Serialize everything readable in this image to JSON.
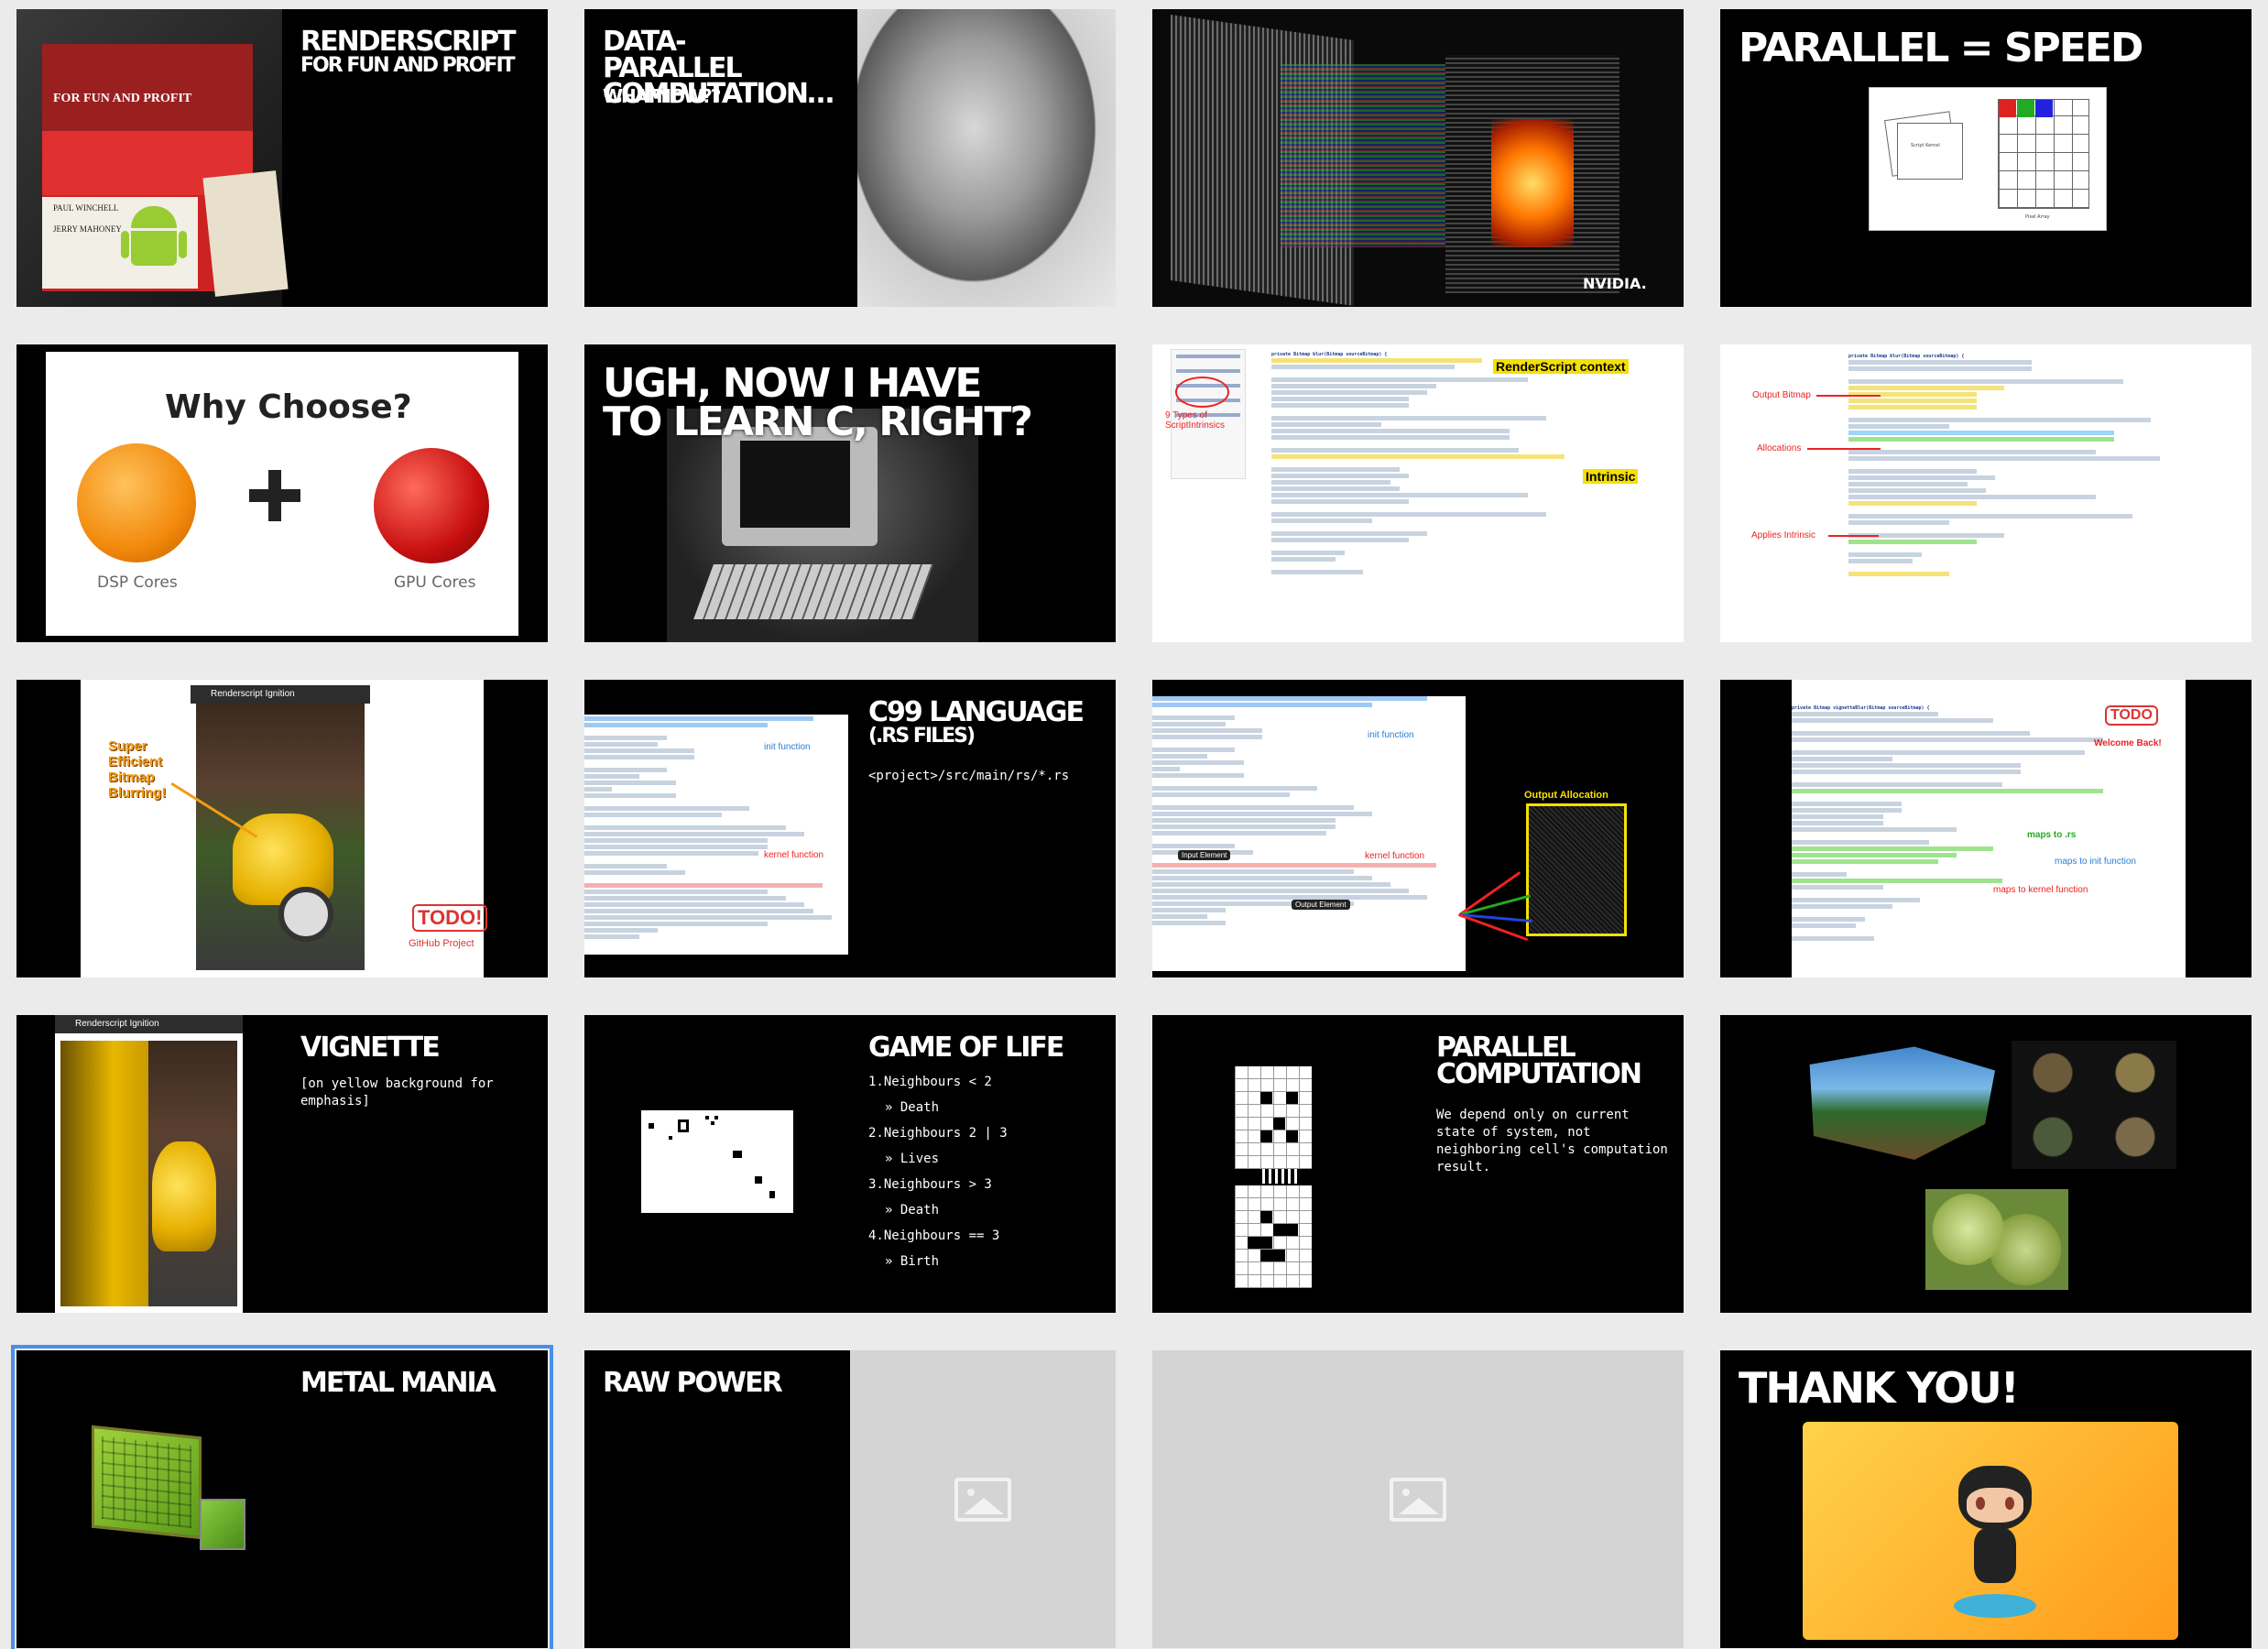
{
  "colors": {
    "background": "#ebebeb",
    "slide": "#000000",
    "selection": "#4a8fe8",
    "accent_red": "#dd3333",
    "accent_yellow": "#f5d60a",
    "annotation_blue": "#2a7fd4"
  },
  "selected_slide": 17,
  "slides": [
    {
      "n": 1,
      "title": "Renderscript",
      "subtitle": "for fun and profit",
      "book_top": "FOR FUN AND PROFIT",
      "book_author": "PAUL WINCHELL",
      "book_author2": "JERRY MAHONEY"
    },
    {
      "n": 2,
      "title": "Data-parallel computation…",
      "subtitle": "whatnow??"
    },
    {
      "n": 3,
      "logo": "NVIDIA."
    },
    {
      "n": 4,
      "title": "Parallel = Speed",
      "label_kernel": "Script Kernel",
      "label_array": "Pixel Array"
    },
    {
      "n": 5,
      "heading": "Why Choose?",
      "left_label": "DSP Cores",
      "right_label": "GPU Cores"
    },
    {
      "n": 6,
      "title": "Ugh, now I have to learn C, right?"
    },
    {
      "n": 7,
      "ann_context": "RenderScript context",
      "ann_intrinsic": "Intrinsic",
      "ann_types": "9 Types of ScriptIntrinsics",
      "code_first": "private Bitmap blur(Bitmap sourceBitmap) {"
    },
    {
      "n": 8,
      "ann_bitmap": "Output Bitmap",
      "ann_alloc": "Allocations",
      "ann_apply": "Applies Intrinsic",
      "code_first": "private Bitmap blur(Bitmap sourceBitmap) {"
    },
    {
      "n": 9,
      "phone_title": "Renderscript Ignition",
      "callout": "Super Efficient Bitmap Blurring!",
      "todo": "TODO!",
      "github": "GitHub Project"
    },
    {
      "n": 10,
      "title": "C99 language",
      "subtitle": "(.rs files)",
      "path": "<project>/src/main/rs/*.rs",
      "ann_init": "init function",
      "ann_kernel": "kernel function"
    },
    {
      "n": 11,
      "ann_init": "init function",
      "ann_kernel": "kernel function",
      "ann_input": "Input Element",
      "ann_output": "Output Element",
      "ann_alloc": "Output Allocation"
    },
    {
      "n": 12,
      "todo": "TODO",
      "welcome": "Welcome Back!",
      "ann_rs": "maps to .rs",
      "ann_init": "maps to init function",
      "ann_kernel": "maps to kernel function",
      "code_first": "private Bitmap vignetteBlur(Bitmap sourceBitmap) {"
    },
    {
      "n": 13,
      "title": "Vignette",
      "body": "[on yellow background for emphasis]",
      "phone_title": "Renderscript Ignition"
    },
    {
      "n": 14,
      "title": "Game of Life",
      "rules": [
        {
          "cond": "1.Neighbours < 2",
          "result": "» Death"
        },
        {
          "cond": "2.Neighbours 2 | 3",
          "result": "» Lives"
        },
        {
          "cond": "3.Neighbours > 3",
          "result": "» Death"
        },
        {
          "cond": "4.Neighbours == 3",
          "result": "» Birth"
        }
      ]
    },
    {
      "n": 15,
      "title": "Parallel computation",
      "body": "We depend only on current state of system, not neighboring cell's computation result."
    },
    {
      "n": 16
    },
    {
      "n": 17,
      "title": "Metal Mania"
    },
    {
      "n": 18,
      "title": "Raw Power"
    },
    {
      "n": 19
    },
    {
      "n": 20,
      "title": "Thank You!"
    }
  ]
}
